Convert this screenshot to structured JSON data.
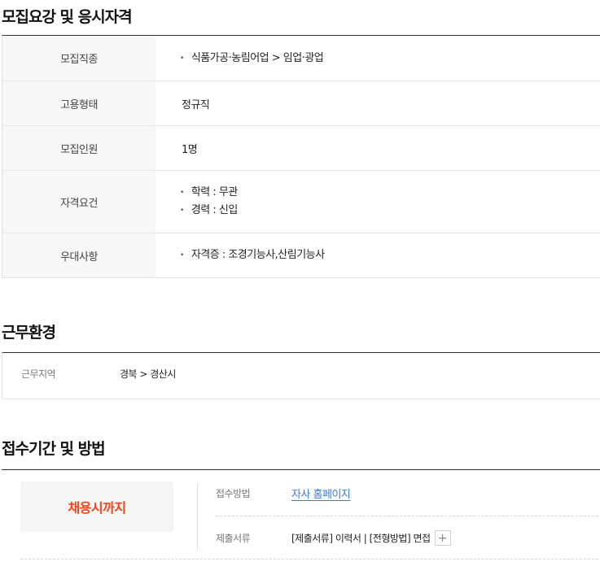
{
  "recruit": {
    "title": "모집요강 및 응시자격",
    "rows": [
      {
        "head": "모집직종",
        "items": [
          "식품가공·농림어업 > 임업·광업"
        ]
      },
      {
        "head": "고용형태",
        "value": "정규직"
      },
      {
        "head": "모집인원",
        "value": "1명"
      },
      {
        "head": "자격요건",
        "items": [
          "학력 : 무관",
          "경력 : 신입"
        ]
      },
      {
        "head": "우대사항",
        "items": [
          "자격증 : 조경기능사,산림기능사"
        ]
      }
    ]
  },
  "work": {
    "title": "근무환경",
    "region_label": "근무지역",
    "region_value": "경북 > 경산시"
  },
  "apply": {
    "title": "접수기간 및 방법",
    "deadline": "채용시까지",
    "method_label": "접수방법",
    "method_value": "자사 홈페이지",
    "docs_label": "제출서류",
    "docs_value": "[제출서류]  이력서  |  [전형방법]  면접",
    "plus": "+"
  },
  "colors": {
    "deadline": "#f0441d",
    "link": "#3a7bd5"
  }
}
